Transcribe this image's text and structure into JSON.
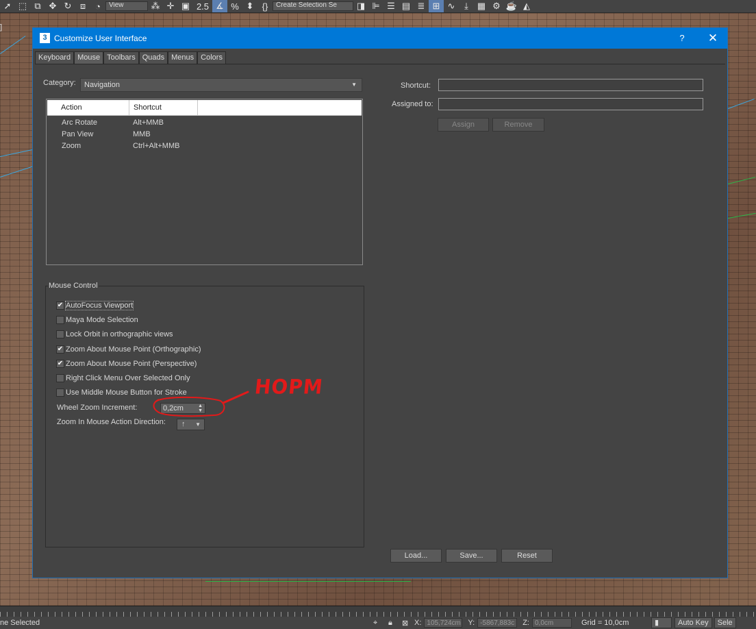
{
  "toolbar": {
    "view_dropdown": "View",
    "snap_value": "2.5",
    "selection_set_dropdown": "Create Selection Se"
  },
  "viewport": {
    "label": "]"
  },
  "dialog": {
    "title": "Customize User Interface",
    "icon_letter": "3",
    "help_label": "?",
    "close_label": "✕",
    "tabs": [
      "Keyboard",
      "Mouse",
      "Toolbars",
      "Quads",
      "Menus",
      "Colors"
    ],
    "active_tab": "Mouse",
    "category_label": "Category:",
    "category_value": "Navigation",
    "list": {
      "columns": [
        "Action",
        "Shortcut"
      ],
      "rows": [
        {
          "action": "Arc Rotate",
          "shortcut": "Alt+MMB"
        },
        {
          "action": "Pan View",
          "shortcut": "MMB"
        },
        {
          "action": "Zoom",
          "shortcut": "Ctrl+Alt+MMB"
        }
      ]
    },
    "shortcut_label": "Shortcut:",
    "assigned_label": "Assigned to:",
    "assign_button": "Assign",
    "remove_button": "Remove",
    "mouse_control": {
      "title": "Mouse Control",
      "options": [
        {
          "label": "AutoFocus Viewport",
          "checked": true
        },
        {
          "label": "Maya Mode Selection",
          "checked": false
        },
        {
          "label": "Lock Orbit in orthographic views",
          "checked": false
        },
        {
          "label": "Zoom About Mouse Point (Orthographic)",
          "checked": true
        },
        {
          "label": "Zoom About Mouse Point (Perspective)",
          "checked": true
        },
        {
          "label": "Right Click Menu Over Selected Only",
          "checked": false
        },
        {
          "label": "Use Middle Mouse Button for Stroke",
          "checked": false
        }
      ],
      "wheel_zoom_label": "Wheel Zoom Increment:",
      "wheel_zoom_value": "0,2cm",
      "zoom_direction_label": "Zoom In Mouse Action Direction:",
      "zoom_direction_value": "↑"
    },
    "load_button": "Load...",
    "save_button": "Save...",
    "reset_button": "Reset"
  },
  "annotation": {
    "text": "НОРМ",
    "color": "#e21a1a"
  },
  "statusbar": {
    "selection_text": "ne Selected",
    "x_label": "X:",
    "x_value": "105,724cm",
    "y_label": "Y:",
    "y_value": "-5867,883c",
    "z_label": "Z:",
    "z_value": "0,0cm",
    "grid_text": "Grid = 10,0cm",
    "autokey_button": "Auto Key",
    "selected_button": "Sele"
  },
  "colors": {
    "title_bar": "#0078d7",
    "dialog_bg": "#444444",
    "annotation": "#e21a1a"
  }
}
